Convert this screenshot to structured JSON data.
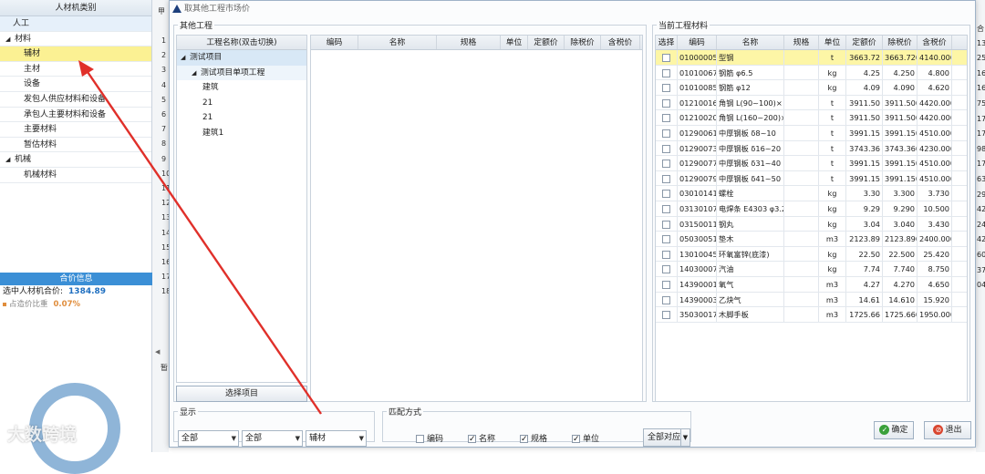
{
  "left_panel": {
    "header": "人材机类别",
    "rows": [
      {
        "label": "人工",
        "kind": "plain"
      },
      {
        "label": "材料",
        "kind": "group"
      },
      {
        "label": "辅材",
        "kind": "child",
        "selected": true
      },
      {
        "label": "主材",
        "kind": "child"
      },
      {
        "label": "设备",
        "kind": "child"
      },
      {
        "label": "发包人供应材料和设备",
        "kind": "child"
      },
      {
        "label": "承包人主要材料和设备",
        "kind": "child"
      },
      {
        "label": "主要材料",
        "kind": "child"
      },
      {
        "label": "暂估材料",
        "kind": "child"
      },
      {
        "label": "机械",
        "kind": "group"
      },
      {
        "label": "机械材料",
        "kind": "child"
      }
    ],
    "price_info": {
      "title": "合价信息",
      "total_label": "选中人材机合价:",
      "total_value": "1384.89",
      "ratio_label": "占造价比重",
      "ratio_value": "0.07%"
    }
  },
  "strip_numbers": [
    "1",
    "2",
    "3",
    "4",
    "5",
    "6",
    "7",
    "8",
    "9",
    "10",
    "11",
    "12",
    "13",
    "14",
    "15",
    "16",
    "17",
    "18"
  ],
  "strip_top_label": "甲",
  "strip_bottom_label": "暂",
  "right_strip_numbers": [
    "合",
    "13",
    "25",
    "16",
    "16",
    "75",
    "17",
    "17",
    "98",
    "17",
    "63",
    "29",
    "42",
    "24",
    "42",
    "60",
    "37",
    "04"
  ],
  "dialog": {
    "title": "取其他工程市场价",
    "other_project": {
      "legend": "其他工程",
      "tree_header": "工程名称(双击切换)",
      "tree": [
        {
          "label": "测试项目",
          "level": 0,
          "selected": true
        },
        {
          "label": "测试项目单项工程",
          "level": 1
        },
        {
          "label": "建筑",
          "level": 2
        },
        {
          "label": "21",
          "level": 2
        },
        {
          "label": "21",
          "level": 2
        },
        {
          "label": "建筑1",
          "level": 2
        }
      ],
      "select_button": "选择项目",
      "grid_columns": [
        "编码",
        "名称",
        "规格",
        "单位",
        "定额价",
        "除税价",
        "含税价"
      ]
    },
    "current": {
      "legend": "当前工程材料",
      "columns": [
        "选择",
        "编码",
        "名称",
        "规格",
        "单位",
        "定额价",
        "除税价",
        "含税价"
      ],
      "rows": [
        {
          "code": "01000005",
          "name": "型钢",
          "spec": "",
          "unit": "t",
          "quota": "3663.72",
          "pretax": "3663.720",
          "taxed": "4140.000",
          "highlight": true
        },
        {
          "code": "01010067",
          "name": "钢筋 φ6.5",
          "spec": "",
          "unit": "kg",
          "quota": "4.25",
          "pretax": "4.250",
          "taxed": "4.800"
        },
        {
          "code": "01010085",
          "name": "钢筋 φ12",
          "spec": "",
          "unit": "kg",
          "quota": "4.09",
          "pretax": "4.090",
          "taxed": "4.620"
        },
        {
          "code": "01210016",
          "name": "角钢 L(90~100)×",
          "spec": "",
          "unit": "t",
          "quota": "3911.50",
          "pretax": "3911.500",
          "taxed": "4420.000"
        },
        {
          "code": "01210020",
          "name": "角钢 L(160~200)×",
          "spec": "",
          "unit": "t",
          "quota": "3911.50",
          "pretax": "3911.500",
          "taxed": "4420.000"
        },
        {
          "code": "01290061",
          "name": "中厚钢板 δ8~10",
          "spec": "",
          "unit": "t",
          "quota": "3991.15",
          "pretax": "3991.150",
          "taxed": "4510.000"
        },
        {
          "code": "01290073",
          "name": "中厚钢板 δ16~20",
          "spec": "",
          "unit": "t",
          "quota": "3743.36",
          "pretax": "3743.360",
          "taxed": "4230.000"
        },
        {
          "code": "01290077",
          "name": "中厚钢板 δ31~40",
          "spec": "",
          "unit": "t",
          "quota": "3991.15",
          "pretax": "3991.150",
          "taxed": "4510.000"
        },
        {
          "code": "01290079",
          "name": "中厚钢板 δ41~50",
          "spec": "",
          "unit": "t",
          "quota": "3991.15",
          "pretax": "3991.150",
          "taxed": "4510.000"
        },
        {
          "code": "03010141",
          "name": "螺栓",
          "spec": "",
          "unit": "kg",
          "quota": "3.30",
          "pretax": "3.300",
          "taxed": "3.730"
        },
        {
          "code": "03130107",
          "name": "电焊条 E4303 φ3.2",
          "spec": "",
          "unit": "kg",
          "quota": "9.29",
          "pretax": "9.290",
          "taxed": "10.500"
        },
        {
          "code": "03150011",
          "name": "钢丸",
          "spec": "",
          "unit": "kg",
          "quota": "3.04",
          "pretax": "3.040",
          "taxed": "3.430"
        },
        {
          "code": "05030051",
          "name": "垫木",
          "spec": "",
          "unit": "m3",
          "quota": "2123.89",
          "pretax": "2123.890",
          "taxed": "2400.000"
        },
        {
          "code": "13010045",
          "name": "环氧富锌(底漆)",
          "spec": "",
          "unit": "kg",
          "quota": "22.50",
          "pretax": "22.500",
          "taxed": "25.420"
        },
        {
          "code": "14030007",
          "name": "汽油",
          "spec": "",
          "unit": "kg",
          "quota": "7.74",
          "pretax": "7.740",
          "taxed": "8.750"
        },
        {
          "code": "14390001",
          "name": "氧气",
          "spec": "",
          "unit": "m3",
          "quota": "4.27",
          "pretax": "4.270",
          "taxed": "4.650"
        },
        {
          "code": "14390003",
          "name": "乙炔气",
          "spec": "",
          "unit": "m3",
          "quota": "14.61",
          "pretax": "14.610",
          "taxed": "15.920"
        },
        {
          "code": "35030017",
          "name": "木脚手板",
          "spec": "",
          "unit": "m3",
          "quota": "1725.66",
          "pretax": "1725.660",
          "taxed": "1950.000"
        }
      ]
    },
    "display": {
      "legend": "显示",
      "select1": "全部",
      "select2": "全部",
      "select3": "辅材"
    },
    "match": {
      "legend": "匹配方式",
      "options": [
        {
          "label": "编码",
          "checked": false
        },
        {
          "label": "名称",
          "checked": true
        },
        {
          "label": "规格",
          "checked": true
        },
        {
          "label": "单位",
          "checked": true
        }
      ],
      "all_match": "全部对应"
    },
    "ok_label": "确定",
    "exit_label": "退出"
  },
  "watermark": "大数跨境",
  "colors": {
    "highlight_row": "#fdf6a6",
    "selected_category": "#fbf193",
    "price_title_bg": "#3b8fd6",
    "arrow": "#e0302a"
  }
}
